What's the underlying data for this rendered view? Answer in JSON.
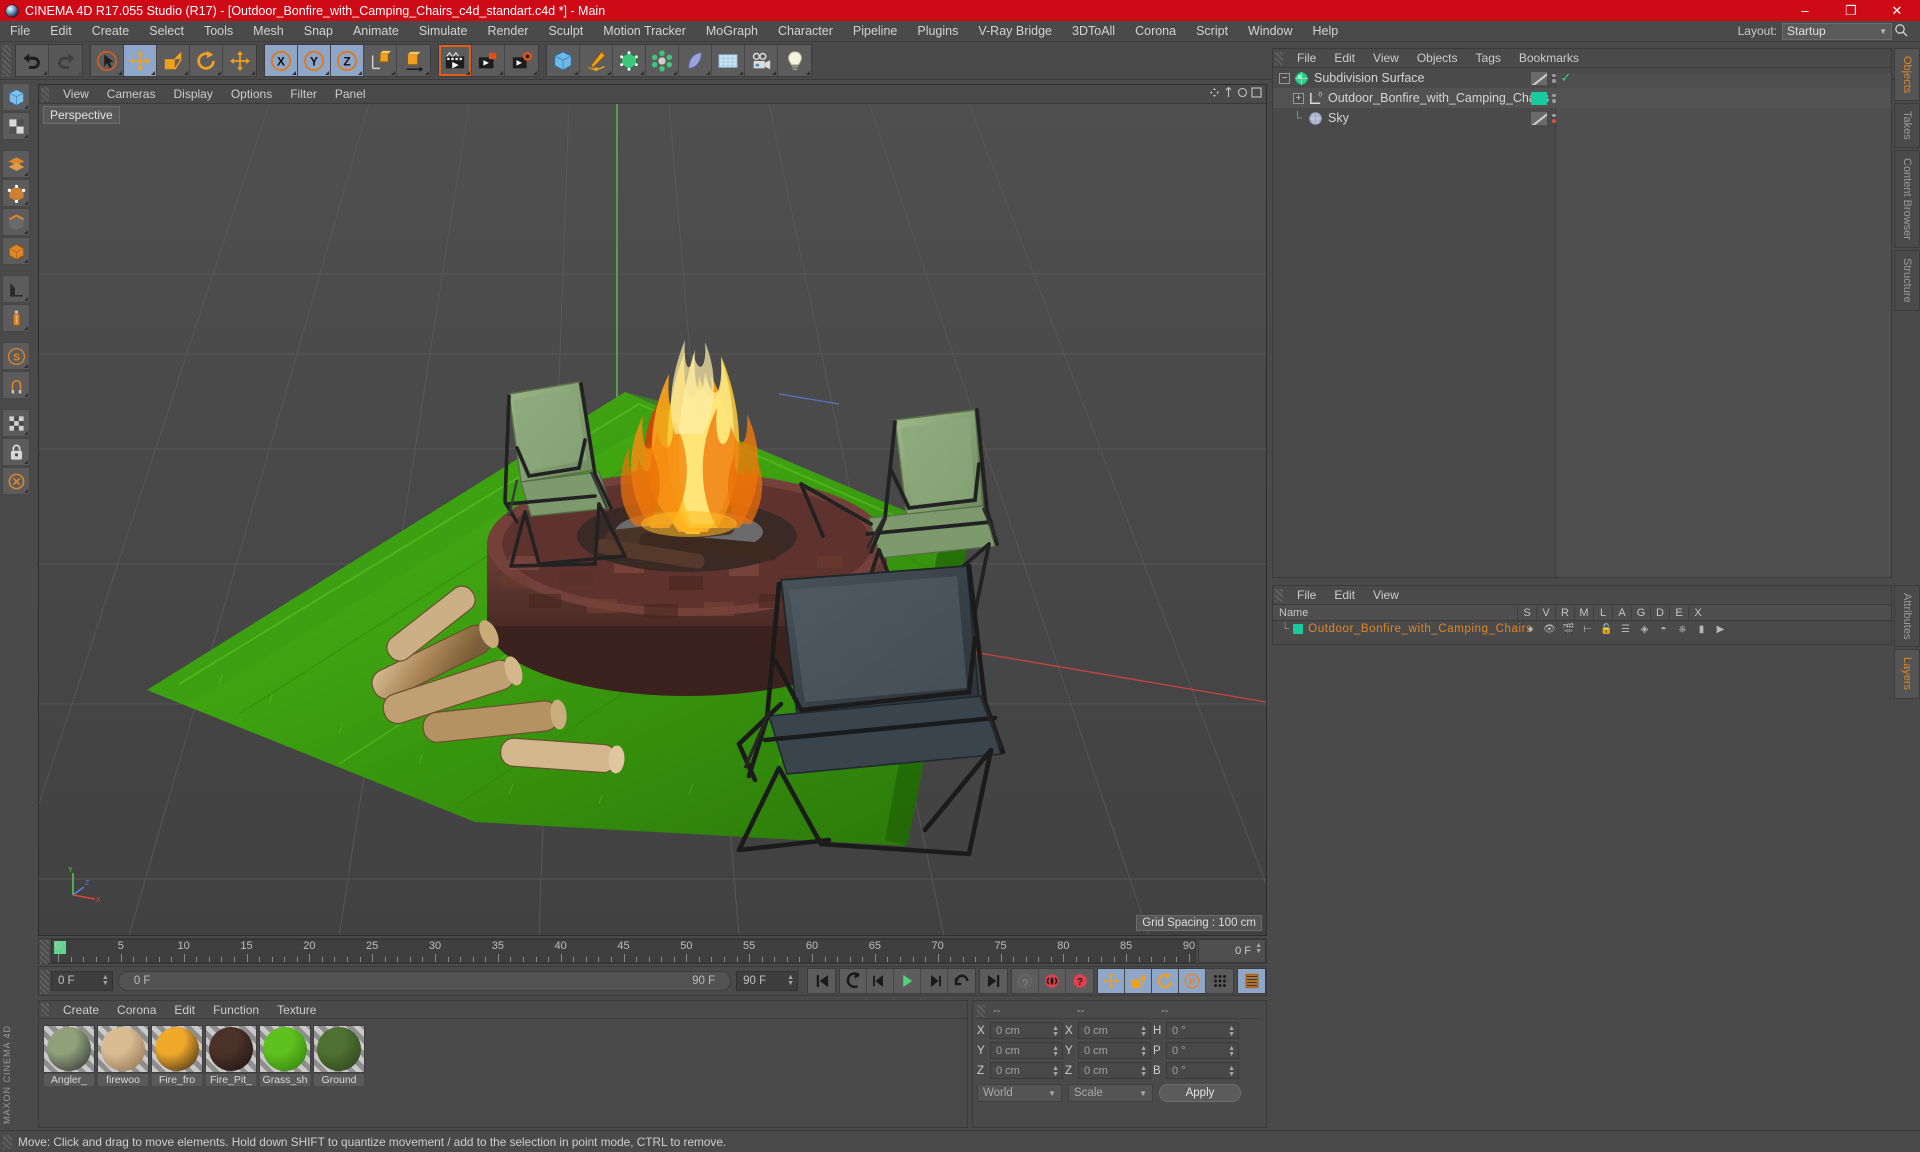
{
  "window": {
    "title": "CINEMA 4D R17.055 Studio (R17) - [Outdoor_Bonfire_with_Camping_Chairs_c4d_standart.c4d *] - Main",
    "minimize_label": "–",
    "maximize_label": "❐",
    "close_label": "✕",
    "titlebar_color": "#cf0a17"
  },
  "menubar": {
    "items": [
      {
        "label": "File"
      },
      {
        "label": "Edit"
      },
      {
        "label": "Create"
      },
      {
        "label": "Select"
      },
      {
        "label": "Tools"
      },
      {
        "label": "Mesh"
      },
      {
        "label": "Snap"
      },
      {
        "label": "Animate"
      },
      {
        "label": "Simulate"
      },
      {
        "label": "Render"
      },
      {
        "label": "Sculpt"
      },
      {
        "label": "Motion Tracker"
      },
      {
        "label": "MoGraph"
      },
      {
        "label": "Character"
      },
      {
        "label": "Pipeline"
      },
      {
        "label": "Plugins"
      },
      {
        "label": "V-Ray Bridge"
      },
      {
        "label": "3DToAll"
      },
      {
        "label": "Corona"
      },
      {
        "label": "Script"
      },
      {
        "label": "Window"
      },
      {
        "label": "Help"
      }
    ],
    "layout_label": "Layout:",
    "layout_value": "Startup"
  },
  "toolbar": {
    "groups": [
      {
        "buttons": [
          {
            "name": "undo-button",
            "icon": "undo"
          },
          {
            "name": "redo-button",
            "icon": "redo",
            "disabled": true
          }
        ]
      },
      {
        "buttons": [
          {
            "name": "select-live-button",
            "icon": "cursor-circle"
          },
          {
            "name": "move-tool-button",
            "icon": "move",
            "active": true
          },
          {
            "name": "scale-tool-button",
            "icon": "scale"
          },
          {
            "name": "rotate-tool-button",
            "icon": "rotate"
          },
          {
            "name": "move-alt-button",
            "icon": "move"
          }
        ]
      },
      {
        "buttons": [
          {
            "name": "axis-x-lock-button",
            "icon": "x-axis",
            "active": true
          },
          {
            "name": "axis-y-lock-button",
            "icon": "y-axis",
            "active": true
          },
          {
            "name": "axis-z-lock-button",
            "icon": "z-axis",
            "active": true
          },
          {
            "name": "world-object-axis-button",
            "icon": "world-axis"
          },
          {
            "name": "object-axis-button",
            "icon": "object-axis"
          }
        ]
      },
      {
        "buttons": [
          {
            "name": "render-view-button",
            "icon": "render-view",
            "highlight": true
          },
          {
            "name": "render-region-button",
            "icon": "render-region"
          },
          {
            "name": "render-settings-button",
            "icon": "render-settings"
          }
        ]
      },
      {
        "buttons": [
          {
            "name": "add-cube-button",
            "icon": "cube"
          },
          {
            "name": "add-spline-button",
            "icon": "pen"
          },
          {
            "name": "add-nurbs-button",
            "icon": "nurbs"
          },
          {
            "name": "add-array-button",
            "icon": "array"
          },
          {
            "name": "add-deformer-button",
            "icon": "deformer"
          },
          {
            "name": "add-environment-button",
            "icon": "environment"
          },
          {
            "name": "add-camera-button",
            "icon": "camera"
          },
          {
            "name": "add-light-button",
            "icon": "light"
          }
        ]
      }
    ]
  },
  "left_toolbar": {
    "buttons": [
      {
        "name": "selection-tool-button",
        "icon": "box-select"
      },
      {
        "name": "magnet-tool-button",
        "icon": "checker"
      },
      {
        "name": "polygon-mode-button",
        "icon": "layers"
      },
      {
        "name": "point-mode-button",
        "icon": "point"
      },
      {
        "name": "edge-mode-button",
        "icon": "edge"
      },
      {
        "name": "model-mode-button",
        "icon": "model"
      },
      {
        "name": "texture-axis-button",
        "icon": "ruler"
      },
      {
        "name": "paint-tool-button",
        "icon": "spray"
      },
      {
        "name": "snap-settings-button",
        "icon": "snap-s"
      },
      {
        "name": "workplane-button",
        "icon": "magnet"
      },
      {
        "name": "enable-axis-button",
        "icon": "checker2"
      },
      {
        "name": "lock-axis-button",
        "icon": "lock"
      },
      {
        "name": "viewport-solo-button",
        "icon": "solo"
      }
    ],
    "brand": "MAXON CINEMA 4D"
  },
  "viewport": {
    "menu": [
      {
        "label": "View"
      },
      {
        "label": "Cameras"
      },
      {
        "label": "Display"
      },
      {
        "label": "Options"
      },
      {
        "label": "Filter"
      },
      {
        "label": "Panel"
      }
    ],
    "label": "Perspective",
    "grid_spacing": "Grid Spacing : 100 cm",
    "axis_labels": {
      "x": "X",
      "y": "Y",
      "z": "Z"
    },
    "scene_description": "Outdoor bonfire with three camping chairs on grass"
  },
  "timeline": {
    "ticks": [
      0,
      5,
      10,
      15,
      20,
      25,
      30,
      35,
      40,
      45,
      50,
      55,
      60,
      65,
      70,
      75,
      80,
      85,
      90
    ],
    "current_frame_label": "0 F",
    "end_frame_label": "90 F",
    "playhead_frame": 0,
    "range_start": "0 F",
    "range_end": "90 F",
    "right_frame_field": "0 F"
  },
  "transport": {
    "buttons": [
      {
        "name": "goto-start-button",
        "icon": "skip-start"
      },
      {
        "name": "step-back-key-button",
        "icon": "prev-key"
      },
      {
        "name": "play-backward-button",
        "icon": "play-back"
      },
      {
        "name": "play-forward-button",
        "icon": "play"
      },
      {
        "name": "step-forward-button",
        "icon": "next-frame"
      },
      {
        "name": "next-key-button",
        "icon": "loop"
      },
      {
        "name": "goto-end-button",
        "icon": "skip-end"
      },
      {
        "name": "autokey-button",
        "icon": "key-disabled"
      },
      {
        "name": "record-active-objects-button",
        "icon": "record-red"
      },
      {
        "name": "record-question-button",
        "icon": "question-red"
      },
      {
        "name": "key-position-button",
        "icon": "move",
        "active": true
      },
      {
        "name": "key-scale-button",
        "icon": "scale",
        "active": true
      },
      {
        "name": "key-rotation-button",
        "icon": "rotate",
        "active": true
      },
      {
        "name": "key-parameter-button",
        "icon": "param-p",
        "active": true
      },
      {
        "name": "key-pla-button",
        "icon": "dots"
      },
      {
        "name": "timeline-view-button",
        "icon": "timeline",
        "active": true
      }
    ]
  },
  "material_manager": {
    "menu": [
      {
        "label": "Create"
      },
      {
        "label": "Corona"
      },
      {
        "label": "Edit"
      },
      {
        "label": "Function"
      },
      {
        "label": "Texture"
      }
    ],
    "materials": [
      {
        "name": "Angler_",
        "color1": "#8fa07a",
        "color2": "#2b2b30"
      },
      {
        "name": "firewoo",
        "color1": "#d8bc92",
        "color2": "#8a6c48"
      },
      {
        "name": "Fire_fro",
        "color1": "#f0a82a",
        "color2": "#2a2218"
      },
      {
        "name": "Fire_Pit_",
        "color1": "#4a3228",
        "color2": "#1a1210"
      },
      {
        "name": "Grass_sh",
        "color1": "#5fc11e",
        "color2": "#2c7a0c"
      },
      {
        "name": "Ground",
        "color1": "#4e7030",
        "color2": "#27401a"
      }
    ]
  },
  "coordinates": {
    "header": [
      "--",
      "--",
      "--"
    ],
    "position": {
      "label_x": "X",
      "label_y": "Y",
      "label_z": "Z",
      "x": "0 cm",
      "y": "0 cm",
      "z": "0 cm"
    },
    "size": {
      "label_x": "X",
      "label_y": "Y",
      "label_z": "Z",
      "x": "0 cm",
      "y": "0 cm",
      "z": "0 cm"
    },
    "rotation": {
      "label_h": "H",
      "label_p": "P",
      "label_b": "B",
      "h": "0 °",
      "p": "0 °",
      "b": "0 °"
    },
    "coord_system": "World",
    "size_mode": "Scale",
    "apply_label": "Apply"
  },
  "object_manager": {
    "menu": [
      {
        "label": "File"
      },
      {
        "label": "Edit"
      },
      {
        "label": "View"
      },
      {
        "label": "Objects"
      },
      {
        "label": "Tags"
      },
      {
        "label": "Bookmarks"
      }
    ],
    "rows": [
      {
        "name": "Subdivision Surface",
        "indent": 0,
        "icon": "subdivision-surface",
        "check": true,
        "tag_color": "none"
      },
      {
        "name": "Outdoor_Bonfire_with_Camping_Chairs",
        "indent": 1,
        "icon": "null-object",
        "check": false,
        "tag_color": "#19c9a0"
      },
      {
        "name": "Sky",
        "indent": 1,
        "icon": "sky",
        "check": false,
        "tag_color": "none",
        "dot_color": "#e0503a"
      }
    ]
  },
  "layer_manager": {
    "menu": [
      {
        "label": "File"
      },
      {
        "label": "Edit"
      },
      {
        "label": "View"
      }
    ],
    "columns": [
      "Name",
      "S",
      "V",
      "R",
      "M",
      "L",
      "A",
      "G",
      "D",
      "E",
      "X"
    ],
    "rows": [
      {
        "name": "Outdoor_Bonfire_with_Camping_Chairs",
        "color": "#19c9a0",
        "text_color": "#e0862a"
      }
    ]
  },
  "right_tabs": {
    "top": [
      {
        "label": "Objects",
        "selected": true
      },
      {
        "label": "Takes",
        "selected": false
      },
      {
        "label": "Content Browser",
        "selected": false
      },
      {
        "label": "Structure",
        "selected": false
      }
    ],
    "bottom": [
      {
        "label": "Attributes",
        "selected": false
      },
      {
        "label": "Layers",
        "selected": true
      }
    ]
  },
  "statusbar": {
    "text": "Move: Click and drag to move elements. Hold down SHIFT to quantize movement / add to the selection in point mode, CTRL to remove."
  }
}
